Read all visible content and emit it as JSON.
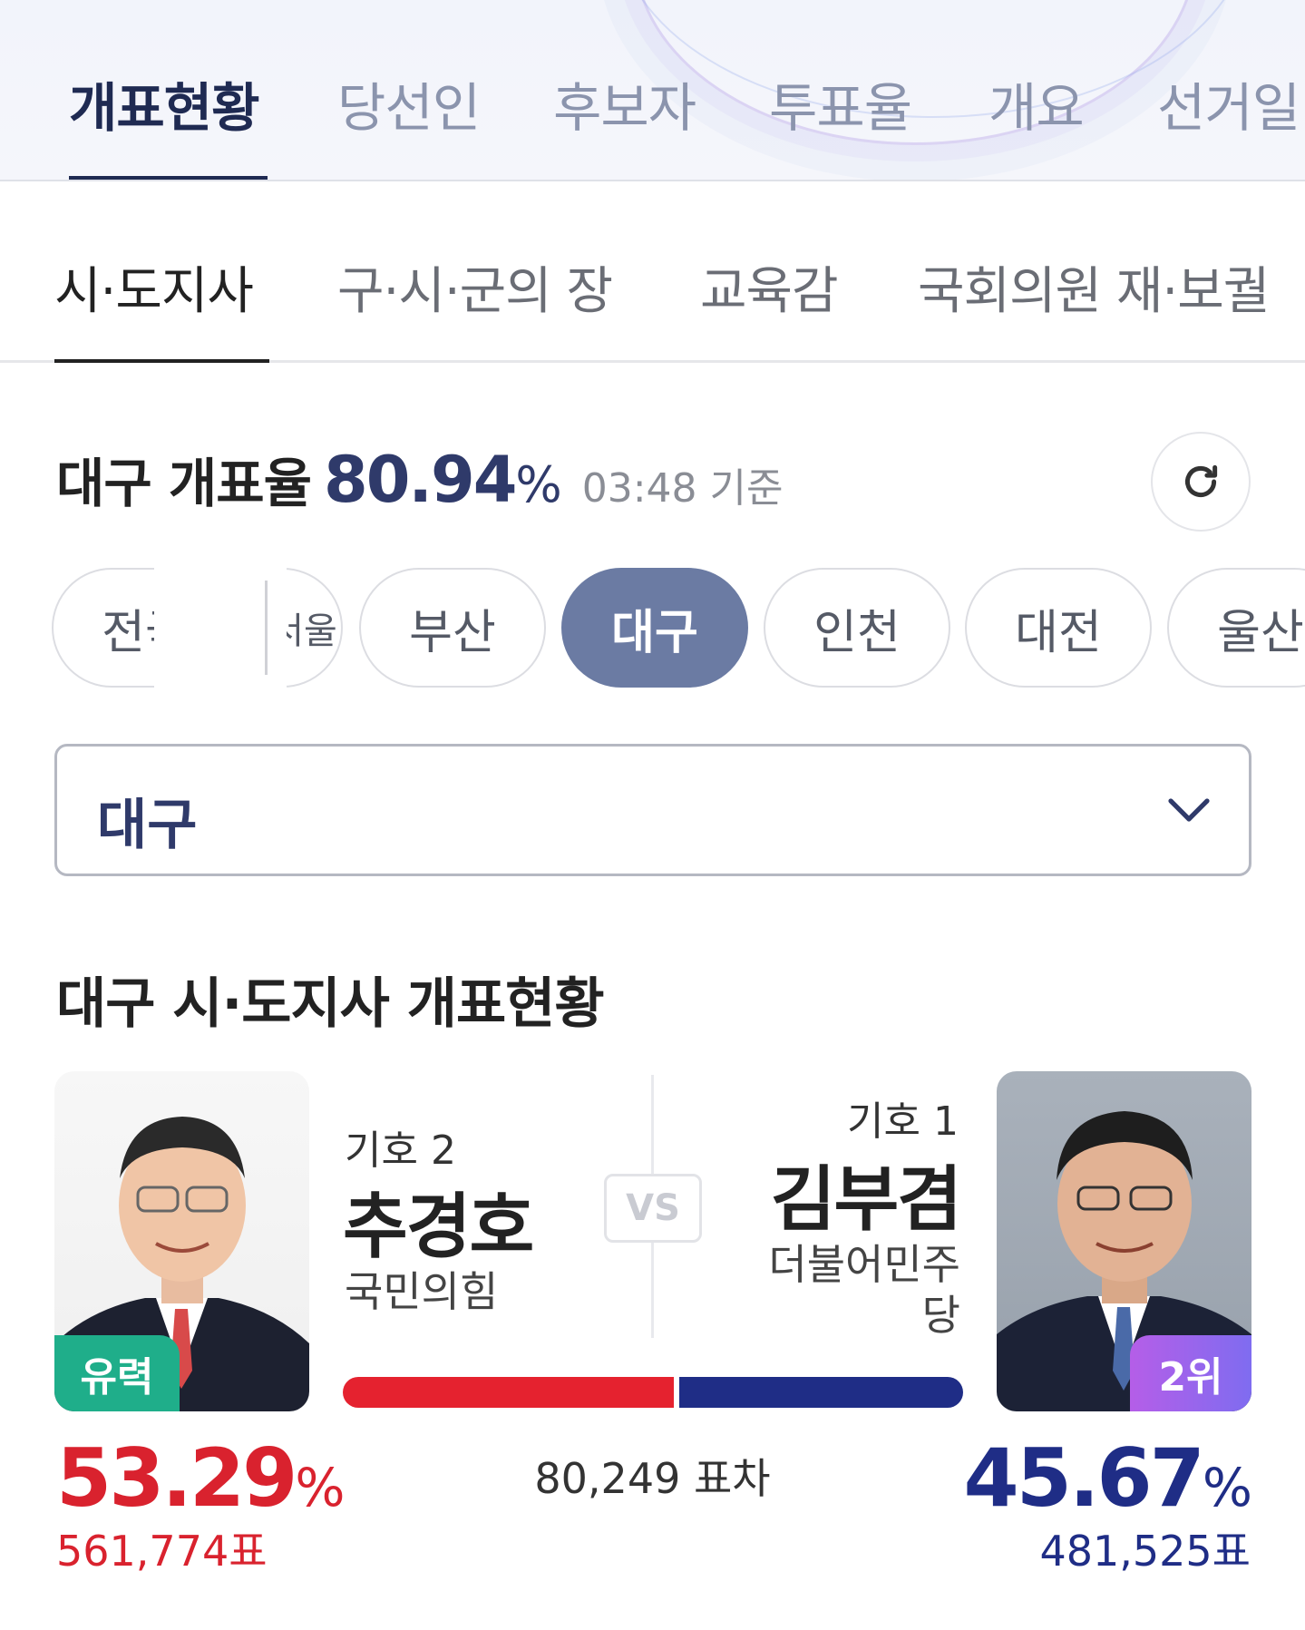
{
  "top_tabs": [
    "개표현황",
    "당선인",
    "후보자",
    "투표율",
    "개요",
    "선거일"
  ],
  "sub_tabs": [
    "시·도지사",
    "구·시·군의 장",
    "교육감",
    "국회의원 재·보궐"
  ],
  "rate": {
    "title": "대구 개표율",
    "value": "80.94",
    "unit": "%",
    "time": "03:48 기준"
  },
  "regions": [
    "전국",
    "서울",
    "부산",
    "대구",
    "인천",
    "대전",
    "울산"
  ],
  "active_region": "대구",
  "select": {
    "value": "대구"
  },
  "section_title": "대구 시·도지사 개표현황",
  "candidates": [
    {
      "number": "기호 2",
      "name": "추경호",
      "party": "국민의힘",
      "badge": "유력",
      "percent": "53.29",
      "unit": "%",
      "votes": "561,774표",
      "color": "#d9222e"
    },
    {
      "number": "기호 1",
      "name": "김부겸",
      "party_line1": "더불어민주",
      "party_line2": "당",
      "badge": "2위",
      "percent": "45.67",
      "unit": "%",
      "votes": "481,525표",
      "color": "#1f2d86"
    }
  ],
  "vs_label": "VS",
  "margin": "80,249 표차",
  "icons": [
    "refresh-icon",
    "chevron-down-icon"
  ]
}
